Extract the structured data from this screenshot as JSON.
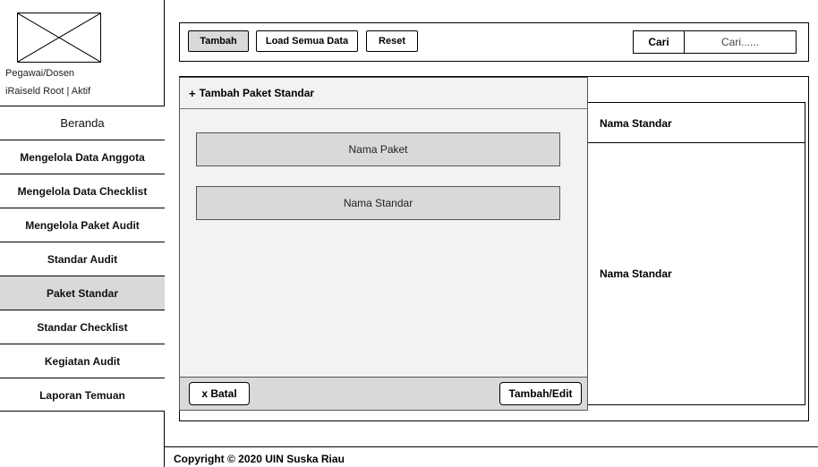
{
  "sidebar": {
    "user_role": "Pegawai/Dosen",
    "user_status": "iRaiseld Root  |  Aktif",
    "items": [
      {
        "label": "Beranda"
      },
      {
        "label": "Mengelola Data Anggota"
      },
      {
        "label": "Mengelola Data Checklist"
      },
      {
        "label": "Mengelola Paket Audit"
      },
      {
        "label": "Standar Audit"
      },
      {
        "label": "Paket Standar",
        "active": true
      },
      {
        "label": "Standar Checklist"
      },
      {
        "label": "Kegiatan Audit"
      },
      {
        "label": "Laporan Temuan"
      }
    ]
  },
  "toolbar": {
    "add_label": "Tambah",
    "load_all_label": "Load Semua Data",
    "reset_label": "Reset",
    "search_label": "Cari",
    "search_placeholder": "Cari......"
  },
  "form": {
    "title": "Tambah Paket Standar",
    "plus_icon": "+",
    "package_name_field": "Nama Paket",
    "standard_name_field": "Nama Standar",
    "cancel_label": "x Batal",
    "submit_label": "Tambah/Edit"
  },
  "table": {
    "header": "Nama Standar",
    "row_value": "Nama Standar"
  },
  "footer": {
    "copyright": "Copyright © 2020 UIN Suska Riau"
  },
  "colors": {
    "active_nav": "#d9d9d9",
    "panel_bg": "#f2f2f2",
    "field_bg": "#d9d9d9",
    "border": "#000000"
  }
}
